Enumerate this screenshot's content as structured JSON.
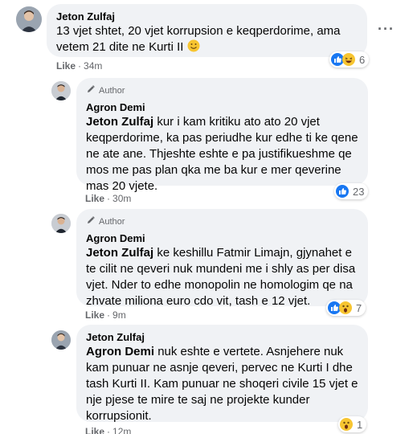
{
  "comments": [
    {
      "author": "Jeton Zulfaj",
      "badge": "",
      "mention": "",
      "text": "13 vjet shtet, 20 vjet korrupsion e keqperdorime, ama vetem 21 dite ne Kurti II",
      "emoji": "smile-emoji",
      "like_label": "Like",
      "time": "34m",
      "reaction_icons": [
        "like-icon",
        "haha-icon"
      ],
      "reaction_count": "6"
    },
    {
      "author": "Agron Demi",
      "badge": "Author",
      "mention": "Jeton Zulfaj",
      "text": "kur i kam kritiku ato ato 20 vjet keqperdorime, ka pas periudhe kur edhe ti ke qene ne ate ane. Thjeshte eshte e pa justifikueshme qe mos me pas plan qka me ba kur e mer qeverine mas 20 vjete.",
      "like_label": "Like",
      "time": "30m",
      "reaction_icons": [
        "like-icon"
      ],
      "reaction_count": "23"
    },
    {
      "author": "Agron Demi",
      "badge": "Author",
      "mention": "Jeton Zulfaj",
      "text": "ke keshillu Fatmir Limajn, gjynahet e te cilit ne qeveri nuk mundeni me i shly as per disa vjet. Nder to edhe monopolin ne homologim qe na zhvate miliona euro cdo vit, tash e 12 vjet.",
      "like_label": "Like",
      "time": "9m",
      "reaction_icons": [
        "like-icon",
        "wow-icon"
      ],
      "reaction_count": "7"
    },
    {
      "author": "Jeton Zulfaj",
      "badge": "",
      "mention": "Agron Demi",
      "text": "nuk eshte e vertete. Asnjehere nuk kam punuar ne asnje qeveri, pervec ne Kurti I dhe tash Kurti II. Kam punuar ne shoqeri civile 15 vjet e nje pjese te mire te saj ne projekte kunder korrupsionit.",
      "like_label": "Like",
      "time": "12m",
      "reaction_icons": [
        "wow-icon"
      ],
      "reaction_count": "1"
    }
  ],
  "more_options_label": "···"
}
